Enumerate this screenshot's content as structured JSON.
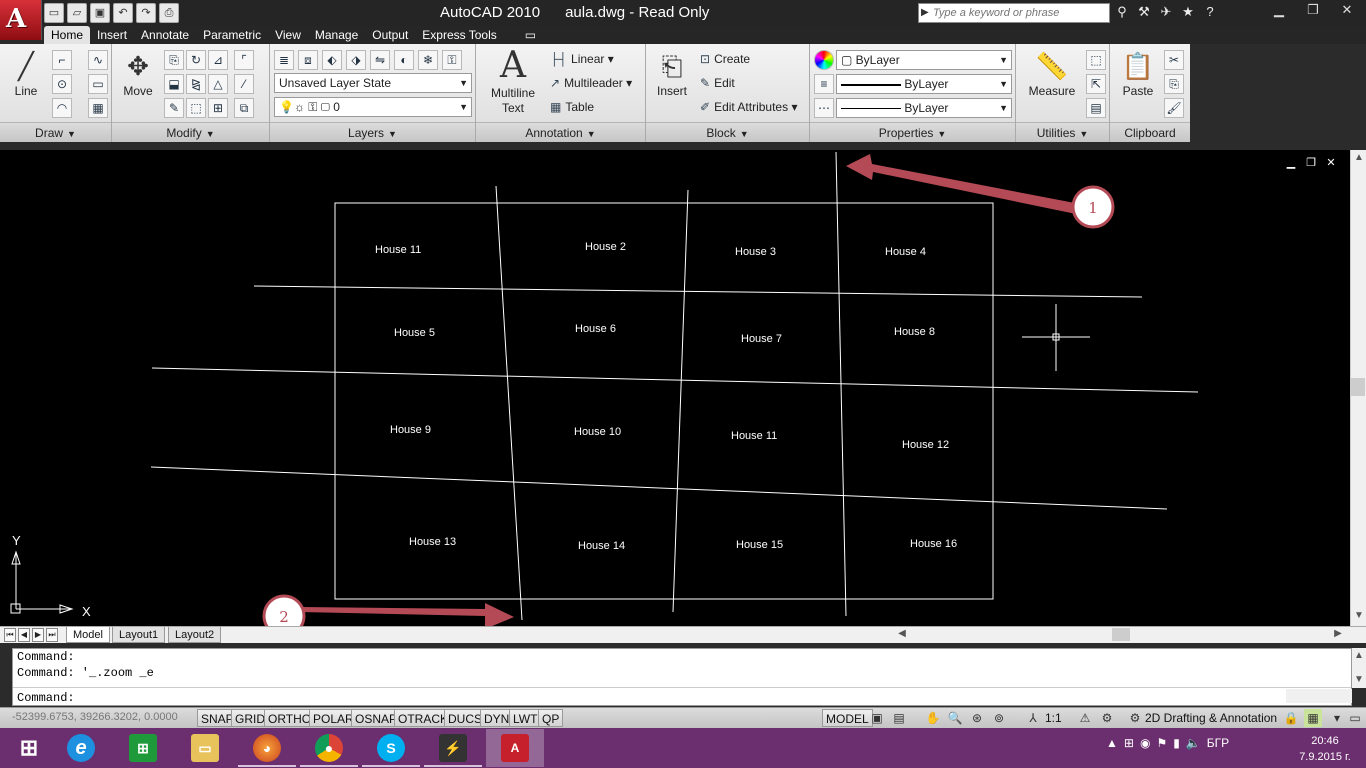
{
  "window": {
    "app_name": "AutoCAD 2010",
    "document": "aula.dwg - Read Only"
  },
  "search": {
    "placeholder": "Type a keyword or phrase"
  },
  "quick_access": [
    "new-icon",
    "open-icon",
    "save-icon",
    "undo-icon",
    "redo-icon",
    "plot-icon"
  ],
  "menu_tabs": [
    "Home",
    "Insert",
    "Annotate",
    "Parametric",
    "View",
    "Manage",
    "Output",
    "Express Tools"
  ],
  "active_tab": "Home",
  "ribbon": {
    "draw": {
      "label": "Draw",
      "line": "Line"
    },
    "modify": {
      "label": "Modify",
      "move": "Move"
    },
    "layers": {
      "label": "Layers",
      "layer_state": "Unsaved Layer State",
      "current_layer": "0"
    },
    "annotation": {
      "label": "Annotation",
      "mtext_1": "Multiline",
      "mtext_2": "Text",
      "linear": "Linear",
      "multileader": "Multileader",
      "table": "Table"
    },
    "block": {
      "label": "Block",
      "insert": "Insert",
      "create": "Create",
      "edit": "Edit",
      "edit_attributes": "Edit Attributes"
    },
    "properties": {
      "label": "Properties",
      "color": "ByLayer",
      "linetype": "ByLayer",
      "lineweight": "ByLayer"
    },
    "utilities": {
      "label": "Utilities",
      "measure": "Measure"
    },
    "clipboard": {
      "label": "Clipboard",
      "paste": "Paste"
    }
  },
  "drawing": {
    "houses": [
      "House 11",
      "House 2",
      "House 3",
      "House 4",
      "House 5",
      "House 6",
      "House 7",
      "House 8",
      "House 9",
      "House 10",
      "House 11",
      "House 12",
      "House 13",
      "House 14",
      "House 15",
      "House 16"
    ],
    "callouts": [
      "1",
      "2"
    ],
    "ucs": {
      "x": "X",
      "y": "Y"
    }
  },
  "layout_tabs": [
    "Model",
    "Layout1",
    "Layout2"
  ],
  "command": {
    "line1": "Command:",
    "line2": "Command: '_.zoom _e",
    "prompt": "Command:"
  },
  "status": {
    "coords": "-52399.6753, 39266.3202, 0.0000",
    "toggles": [
      "SNAP",
      "GRID",
      "ORTHO",
      "POLAR",
      "OSNAP",
      "OTRACK",
      "DUCS",
      "DYN",
      "LWT",
      "QP"
    ],
    "space": "MODEL",
    "scale": "1:1",
    "workspace": "2D Drafting & Annotation"
  },
  "taskbar": {
    "apps": [
      "windows-start",
      "internet-explorer",
      "windows-store",
      "file-explorer",
      "firefox",
      "chrome",
      "skype",
      "winamp",
      "autocad-2010"
    ],
    "language": "БГР",
    "time": "20:46",
    "date": "7.9.2015 г."
  },
  "colors": {
    "accent_red": "#b44a55",
    "canvas": "#000000",
    "taskbar": "#6b2e6e"
  }
}
